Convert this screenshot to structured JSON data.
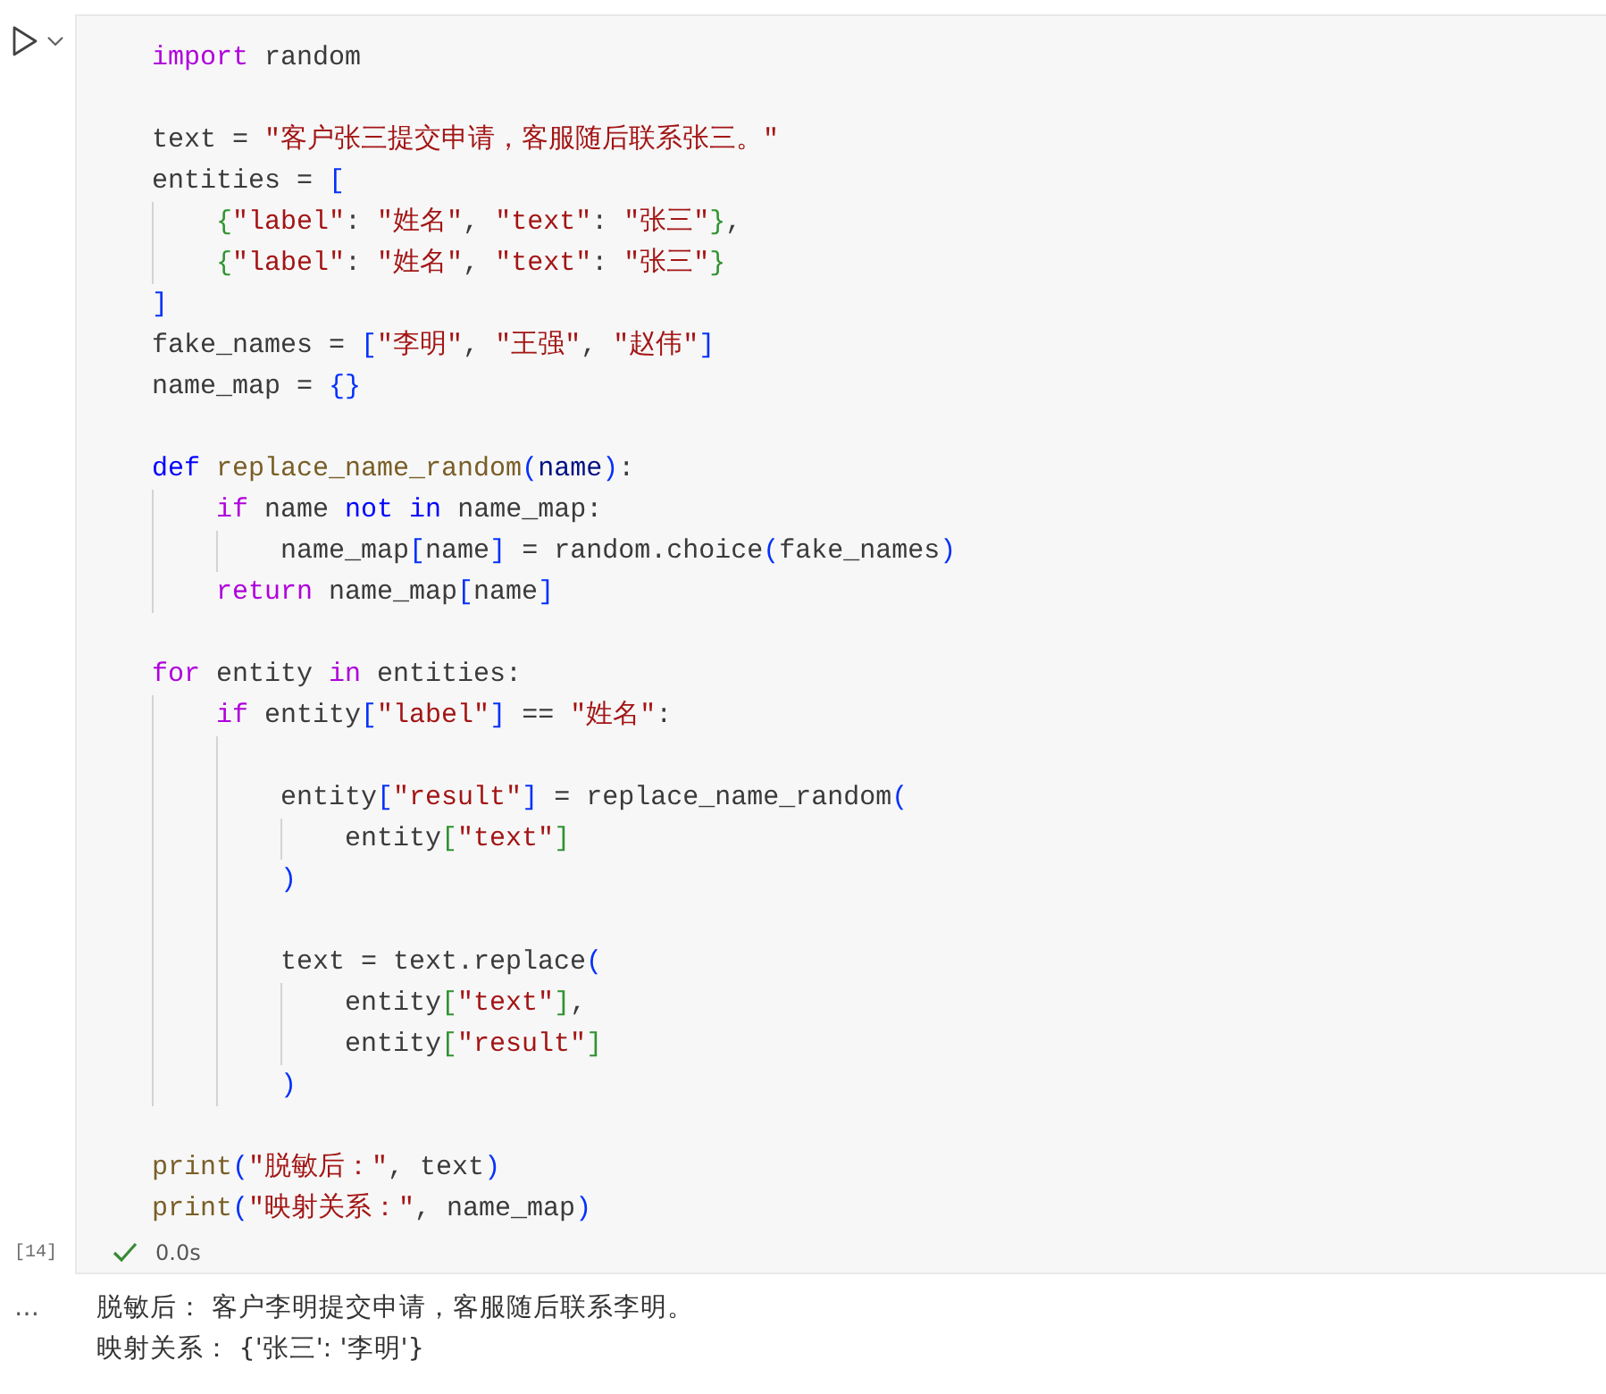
{
  "cell": {
    "execution_count": "[14]",
    "succeeded": true,
    "duration": "0.0s",
    "code_lines": [
      {
        "kind": "code",
        "tokens": [
          {
            "kind": "control",
            "text": "import"
          },
          {
            "kind": "plain",
            "text": " random"
          }
        ]
      },
      {
        "kind": "blank"
      },
      {
        "kind": "code",
        "tokens": [
          {
            "kind": "plain",
            "text": "text = "
          },
          {
            "kind": "string",
            "text": "\"客户张三提交申请，客服随后联系张三。\""
          }
        ]
      },
      {
        "kind": "code",
        "tokens": [
          {
            "kind": "plain",
            "text": "entities = "
          },
          {
            "kind": "bracket1",
            "text": "["
          }
        ]
      },
      {
        "kind": "code",
        "tokens": [
          {
            "kind": "bracket2",
            "text": "    {"
          },
          {
            "kind": "string",
            "text": "\"label\""
          },
          {
            "kind": "plain",
            "text": ": "
          },
          {
            "kind": "string",
            "text": "\"姓名\""
          },
          {
            "kind": "plain",
            "text": ", "
          },
          {
            "kind": "string",
            "text": "\"text\""
          },
          {
            "kind": "plain",
            "text": ": "
          },
          {
            "kind": "string",
            "text": "\"张三\""
          },
          {
            "kind": "bracket2",
            "text": "}"
          },
          {
            "kind": "plain",
            "text": ","
          }
        ]
      },
      {
        "kind": "code",
        "tokens": [
          {
            "kind": "bracket2",
            "text": "    {"
          },
          {
            "kind": "string",
            "text": "\"label\""
          },
          {
            "kind": "plain",
            "text": ": "
          },
          {
            "kind": "string",
            "text": "\"姓名\""
          },
          {
            "kind": "plain",
            "text": ", "
          },
          {
            "kind": "string",
            "text": "\"text\""
          },
          {
            "kind": "plain",
            "text": ": "
          },
          {
            "kind": "string",
            "text": "\"张三\""
          },
          {
            "kind": "bracket2",
            "text": "}"
          }
        ]
      },
      {
        "kind": "code",
        "tokens": [
          {
            "kind": "bracket1",
            "text": "]"
          }
        ]
      },
      {
        "kind": "code",
        "tokens": [
          {
            "kind": "plain",
            "text": "fake_names = "
          },
          {
            "kind": "bracket1",
            "text": "["
          },
          {
            "kind": "string",
            "text": "\"李明\""
          },
          {
            "kind": "plain",
            "text": ", "
          },
          {
            "kind": "string",
            "text": "\"王强\""
          },
          {
            "kind": "plain",
            "text": ", "
          },
          {
            "kind": "string",
            "text": "\"赵伟\""
          },
          {
            "kind": "bracket1",
            "text": "]"
          }
        ]
      },
      {
        "kind": "code",
        "tokens": [
          {
            "kind": "plain",
            "text": "name_map = "
          },
          {
            "kind": "bracket1",
            "text": "{}"
          }
        ]
      },
      {
        "kind": "blank"
      },
      {
        "kind": "code",
        "tokens": [
          {
            "kind": "storage",
            "text": "def"
          },
          {
            "kind": "function",
            "text": " replace_name_random"
          },
          {
            "kind": "bracket1",
            "text": "("
          },
          {
            "kind": "param",
            "text": "name"
          },
          {
            "kind": "bracket1",
            "text": ")"
          },
          {
            "kind": "plain",
            "text": ":"
          }
        ]
      },
      {
        "kind": "code",
        "tokens": [
          {
            "kind": "control",
            "text": "    if"
          },
          {
            "kind": "plain",
            "text": " name "
          },
          {
            "kind": "storage",
            "text": "not"
          },
          {
            "kind": "storage",
            "text": " in"
          },
          {
            "kind": "plain",
            "text": " name_map:"
          }
        ]
      },
      {
        "kind": "code",
        "tokens": [
          {
            "kind": "plain",
            "text": "        name_map"
          },
          {
            "kind": "bracket1",
            "text": "["
          },
          {
            "kind": "plain",
            "text": "name"
          },
          {
            "kind": "bracket1",
            "text": "]"
          },
          {
            "kind": "plain",
            "text": " = random.choice"
          },
          {
            "kind": "bracket1",
            "text": "("
          },
          {
            "kind": "plain",
            "text": "fake_names"
          },
          {
            "kind": "bracket1",
            "text": ")"
          }
        ]
      },
      {
        "kind": "code",
        "tokens": [
          {
            "kind": "control",
            "text": "    return"
          },
          {
            "kind": "plain",
            "text": " name_map"
          },
          {
            "kind": "bracket1",
            "text": "["
          },
          {
            "kind": "plain",
            "text": "name"
          },
          {
            "kind": "bracket1",
            "text": "]"
          }
        ]
      },
      {
        "kind": "blank"
      },
      {
        "kind": "code",
        "tokens": [
          {
            "kind": "control",
            "text": "for"
          },
          {
            "kind": "plain",
            "text": " entity "
          },
          {
            "kind": "control",
            "text": "in"
          },
          {
            "kind": "plain",
            "text": " entities:"
          }
        ]
      },
      {
        "kind": "code",
        "tokens": [
          {
            "kind": "control",
            "text": "    if"
          },
          {
            "kind": "plain",
            "text": " entity"
          },
          {
            "kind": "bracket1",
            "text": "["
          },
          {
            "kind": "string",
            "text": "\"label\""
          },
          {
            "kind": "bracket1",
            "text": "]"
          },
          {
            "kind": "plain",
            "text": " == "
          },
          {
            "kind": "string",
            "text": "\"姓名\""
          },
          {
            "kind": "plain",
            "text": ":"
          }
        ]
      },
      {
        "kind": "blank"
      },
      {
        "kind": "code",
        "tokens": [
          {
            "kind": "plain",
            "text": "        entity"
          },
          {
            "kind": "bracket1",
            "text": "["
          },
          {
            "kind": "string",
            "text": "\"result\""
          },
          {
            "kind": "bracket1",
            "text": "]"
          },
          {
            "kind": "plain",
            "text": " = replace_name_random"
          },
          {
            "kind": "bracket1",
            "text": "("
          }
        ]
      },
      {
        "kind": "code",
        "tokens": [
          {
            "kind": "plain",
            "text": "            entity"
          },
          {
            "kind": "bracket2",
            "text": "["
          },
          {
            "kind": "string",
            "text": "\"text\""
          },
          {
            "kind": "bracket2",
            "text": "]"
          }
        ]
      },
      {
        "kind": "code",
        "tokens": [
          {
            "kind": "bracket1",
            "text": "        )"
          }
        ]
      },
      {
        "kind": "blank"
      },
      {
        "kind": "code",
        "tokens": [
          {
            "kind": "plain",
            "text": "        text = text.replace"
          },
          {
            "kind": "bracket1",
            "text": "("
          }
        ]
      },
      {
        "kind": "code",
        "tokens": [
          {
            "kind": "plain",
            "text": "            entity"
          },
          {
            "kind": "bracket2",
            "text": "["
          },
          {
            "kind": "string",
            "text": "\"text\""
          },
          {
            "kind": "bracket2",
            "text": "]"
          },
          {
            "kind": "plain",
            "text": ","
          }
        ]
      },
      {
        "kind": "code",
        "tokens": [
          {
            "kind": "plain",
            "text": "            entity"
          },
          {
            "kind": "bracket2",
            "text": "["
          },
          {
            "kind": "string",
            "text": "\"result\""
          },
          {
            "kind": "bracket2",
            "text": "]"
          }
        ]
      },
      {
        "kind": "code",
        "tokens": [
          {
            "kind": "bracket1",
            "text": "        )"
          }
        ]
      },
      {
        "kind": "blank"
      },
      {
        "kind": "code",
        "tokens": [
          {
            "kind": "function",
            "text": "print"
          },
          {
            "kind": "bracket1",
            "text": "("
          },
          {
            "kind": "string",
            "text": "\"脱敏后：\""
          },
          {
            "kind": "plain",
            "text": ", text"
          },
          {
            "kind": "bracket1",
            "text": ")"
          }
        ]
      },
      {
        "kind": "code",
        "tokens": [
          {
            "kind": "function",
            "text": "print"
          },
          {
            "kind": "bracket1",
            "text": "("
          },
          {
            "kind": "string",
            "text": "\"映射关系：\""
          },
          {
            "kind": "plain",
            "text": ", name_map"
          },
          {
            "kind": "bracket1",
            "text": ")"
          }
        ]
      }
    ]
  },
  "output": {
    "menu": "…",
    "lines": [
      "脱敏后： 客户李明提交申请，客服随后联系李明。",
      "映射关系： {'张三': '李明'}"
    ]
  }
}
